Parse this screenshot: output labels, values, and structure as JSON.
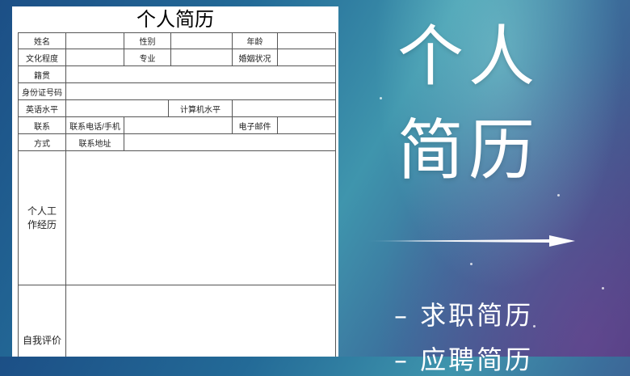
{
  "resume": {
    "title": "个人简历",
    "fields": {
      "name": "姓名",
      "gender": "性别",
      "age": "年龄",
      "education": "文化程度",
      "major": "专业",
      "marital": "婚姻状况",
      "native_place": "籍贯",
      "id_number": "身份证号码",
      "english_level": "英语水平",
      "computer_level": "计算机水平",
      "contact_1": "联系",
      "contact_2": "方式",
      "phone": "联系电话/手机",
      "email": "电子邮件",
      "address": "联系地址",
      "work_experience": "个人工作经历",
      "self_evaluation": "自我评价"
    }
  },
  "hero": {
    "line1": "个人",
    "line2": "简历",
    "sub1": "– 求职简历",
    "sub2": "– 应聘简历"
  },
  "colors": {
    "background_start": "#1c4f86",
    "background_mid": "#3f95ad",
    "background_end": "#433f7e",
    "sheet": "#ffffff",
    "hero_text": "#ffffff"
  }
}
